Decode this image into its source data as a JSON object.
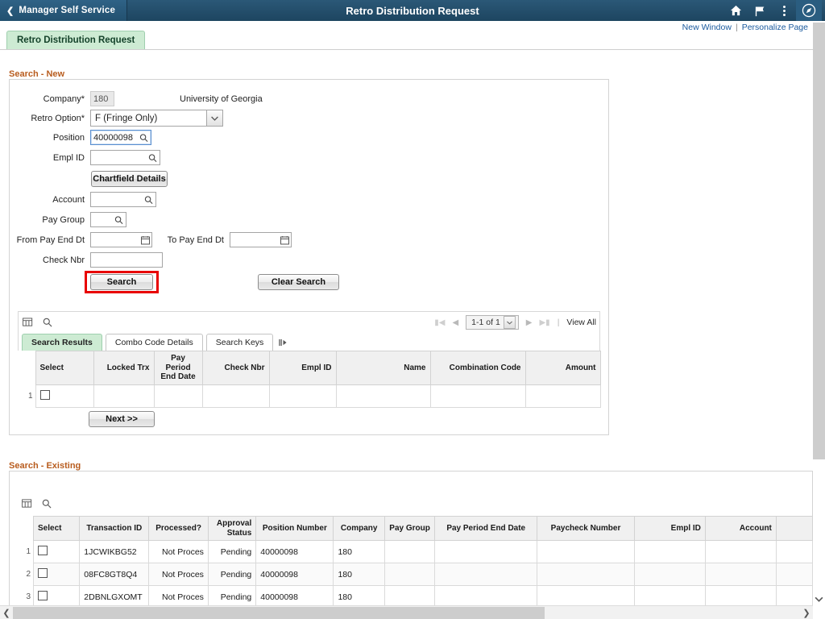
{
  "header": {
    "back_label": "Manager Self Service",
    "title": "Retro Distribution Request",
    "icons": [
      "home-icon",
      "flag-icon",
      "actions-menu-icon",
      "navbar-icon"
    ]
  },
  "subbar": {
    "new_window": "New Window",
    "separator": "|",
    "personalize_page": "Personalize Page"
  },
  "page_tab": {
    "label": "Retro Distribution Request"
  },
  "search_new": {
    "section_label": "Search - New",
    "company": {
      "label": "Company*",
      "value": "180",
      "description": "University of Georgia"
    },
    "retro_option": {
      "label": "Retro Option*",
      "value": "F (Fringe Only)"
    },
    "position": {
      "label": "Position",
      "value": "40000098",
      "placeholder": ""
    },
    "empl_id": {
      "label": "Empl ID",
      "value": "",
      "placeholder": ""
    },
    "chartfield_button": "Chartfield Details",
    "account": {
      "label": "Account",
      "value": "",
      "placeholder": ""
    },
    "pay_group": {
      "label": "Pay Group",
      "value": "",
      "placeholder": ""
    },
    "from_pay_end_dt": {
      "label": "From Pay End Dt",
      "value": "",
      "placeholder": ""
    },
    "to_pay_end_dt": {
      "label": "To Pay End Dt",
      "value": "",
      "placeholder": ""
    },
    "check_nbr": {
      "label": "Check Nbr",
      "value": "",
      "placeholder": ""
    },
    "search_button": "Search",
    "clear_search_button": "Clear Search",
    "next_button": "Next >>"
  },
  "results_grid": {
    "toolbar": {
      "personalize_icon": "grid-personalize-icon",
      "find_icon": "search-icon",
      "first_arrow": "first-page-icon",
      "prev_arrow": "previous-page-icon",
      "page_range": "1-1 of 1",
      "dropdown_icon": "chevron-down-icon",
      "next_arrow": "next-page-icon",
      "last_arrow": "last-page-icon",
      "divider": "|",
      "view_all": "View All"
    },
    "tabs": [
      {
        "label": "Search Results",
        "active": true
      },
      {
        "label": "Combo Code Details",
        "active": false
      },
      {
        "label": "Search Keys",
        "active": false
      }
    ],
    "tab_overflow_icon": "tab-overflow-icon",
    "columns": [
      "Select",
      "Locked Trx",
      "Pay Period End Date",
      "Check Nbr",
      "Empl ID",
      "Name",
      "Combination Code",
      "Amount"
    ],
    "rows": [
      {
        "num": "1",
        "select": false,
        "locked_trx": "",
        "pay_period_end_date": "",
        "check_nbr": "",
        "empl_id": "",
        "name": "",
        "combination_code": "",
        "amount": ""
      }
    ]
  },
  "search_existing": {
    "section_label": "Search - Existing",
    "toolbar": {
      "personalize_icon": "grid-personalize-icon",
      "find_icon": "search-icon"
    },
    "columns": [
      "Select",
      "Transaction ID",
      "Processed?",
      "Approval Status",
      "Position Number",
      "Company",
      "Pay Group",
      "Pay Period End Date",
      "Paycheck Number",
      "Empl ID",
      "Account",
      ""
    ],
    "rows": [
      {
        "num": "1",
        "select": false,
        "transaction_id": "1JCWIKBG52",
        "processed": "Not Proces",
        "approval_status": "Pending",
        "position_number": "40000098",
        "company": "180",
        "pay_group": "",
        "pay_period_end_date": "",
        "paycheck_number": "",
        "empl_id": "",
        "account": "",
        "extra": ""
      },
      {
        "num": "2",
        "select": false,
        "transaction_id": "08FC8GT8Q4",
        "processed": "Not Proces",
        "approval_status": "Pending",
        "position_number": "40000098",
        "company": "180",
        "pay_group": "",
        "pay_period_end_date": "",
        "paycheck_number": "",
        "empl_id": "",
        "account": "",
        "extra": ""
      },
      {
        "num": "3",
        "select": false,
        "transaction_id": "2DBNLGXOMT",
        "processed": "Not Proces",
        "approval_status": "Pending",
        "position_number": "40000098",
        "company": "180",
        "pay_group": "",
        "pay_period_end_date": "",
        "paycheck_number": "",
        "empl_id": "",
        "account": "",
        "extra": ""
      }
    ]
  },
  "scrollbars": {
    "vertical_up_icon": "chevron-up-icon",
    "vertical_down_icon": "chevron-down-icon",
    "horizontal_left_icon": "chevron-left-icon",
    "horizontal_right_icon": "chevron-right-icon"
  },
  "colors": {
    "header_blue": "#22506f",
    "tab_green": "#cdebd3",
    "section_orange": "#b85c1e",
    "highlight_red": "#e80000",
    "link_blue": "#1a5a9e"
  }
}
